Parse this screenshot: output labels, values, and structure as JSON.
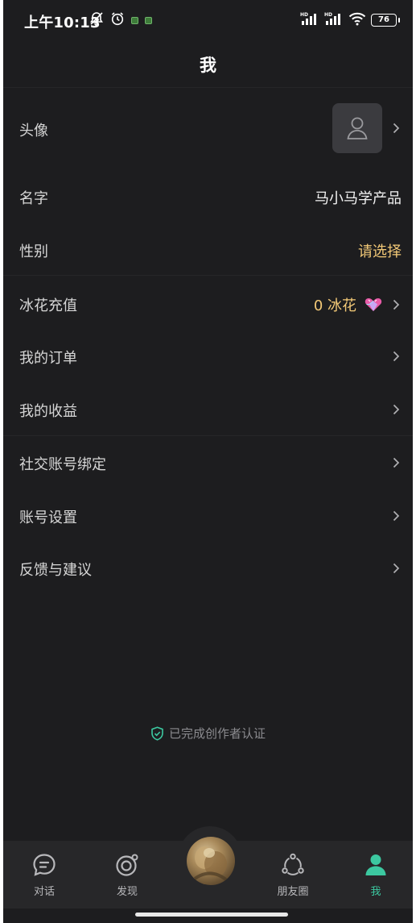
{
  "status_bar": {
    "time": "上午10:13",
    "battery": "76"
  },
  "header": {
    "title": "我"
  },
  "rows": {
    "avatar": {
      "label": "头像"
    },
    "name": {
      "label": "名字",
      "value": "马小马学产品"
    },
    "gender": {
      "label": "性别",
      "value": "请选择"
    },
    "recharge": {
      "label": "冰花充值",
      "value": "0 冰花"
    },
    "orders": {
      "label": "我的订单"
    },
    "earnings": {
      "label": "我的收益"
    },
    "social": {
      "label": "社交账号绑定"
    },
    "account": {
      "label": "账号设置"
    },
    "feedback": {
      "label": "反馈与建议"
    }
  },
  "certification": {
    "text": "已完成创作者认证"
  },
  "tabbar": {
    "chat": "对话",
    "discover": "发现",
    "moments": "朋友圈",
    "me": "我"
  },
  "colors": {
    "background": "#1d1d1f",
    "accent": "#3cc8a0",
    "gold": "#f3c977",
    "tabbar": "#272729"
  }
}
